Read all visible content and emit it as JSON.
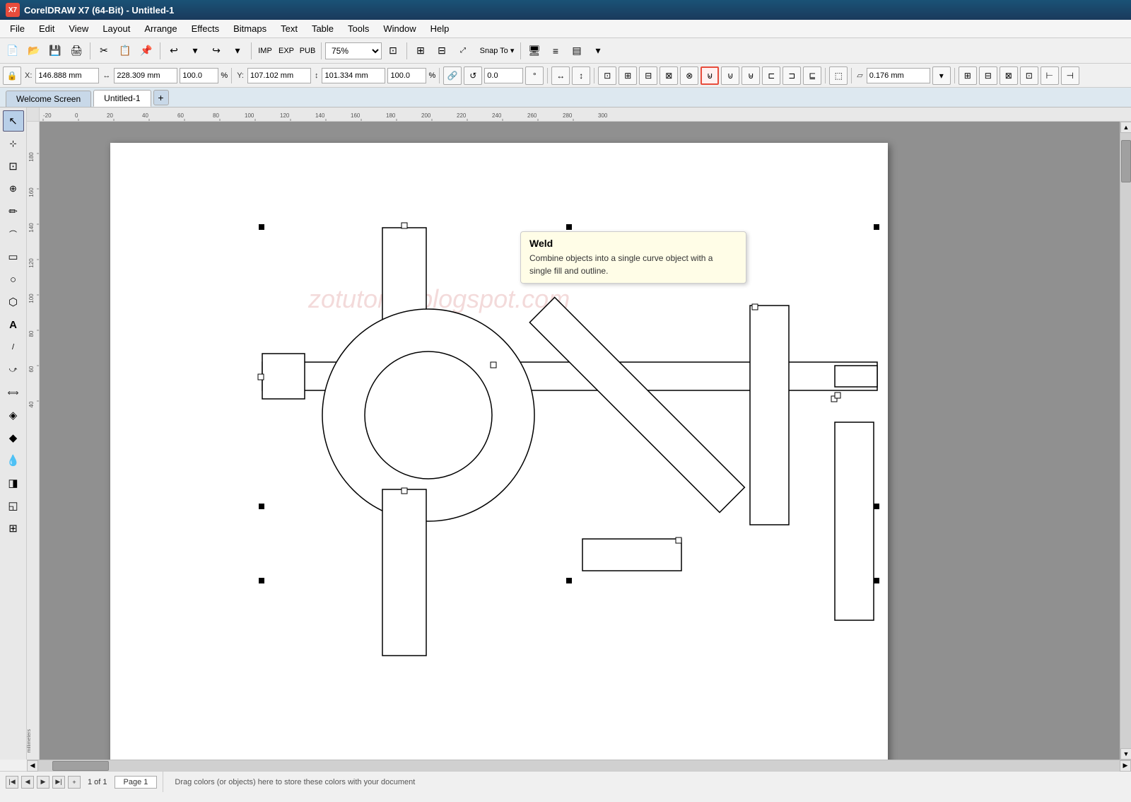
{
  "app": {
    "title": "CorelDRAW X7 (64-Bit) - Untitled-1",
    "logo_text": "X7"
  },
  "menubar": {
    "items": [
      "File",
      "Edit",
      "View",
      "Layout",
      "Arrange",
      "Effects",
      "Bitmaps",
      "Text",
      "Table",
      "Tools",
      "Window",
      "Help"
    ]
  },
  "toolbar": {
    "zoom_value": "75%",
    "snap_to_label": "Snap To"
  },
  "propbar": {
    "x_label": "X:",
    "x_value": "146.888 mm",
    "y_label": "Y:",
    "y_value": "107.102 mm",
    "w_value": "228.309 mm",
    "h_value": "101.334 mm",
    "scale_w": "100.0",
    "scale_h": "100.0",
    "angle_value": "0.0",
    "outline_value": "0.176 mm"
  },
  "tabs": {
    "items": [
      "Welcome Screen",
      "Untitled-1"
    ],
    "active": 1,
    "add_label": "+"
  },
  "tooltip": {
    "title": "Weld",
    "description": "Combine objects into a single curve object with a single fill and outline."
  },
  "canvas": {
    "watermark": "zotutorial.blogspot.com",
    "page_label": "Page 1"
  },
  "statusbar": {
    "page_count": "1 of 1",
    "page_name": "Page 1",
    "message": "Drag colors (or objects) here to store these colors with your document"
  },
  "tools": {
    "items": [
      {
        "name": "select-tool",
        "icon": "↖",
        "label": "Pick Tool"
      },
      {
        "name": "node-tool",
        "icon": "⊹",
        "label": "Node Tool"
      },
      {
        "name": "crop-tool",
        "icon": "⊡",
        "label": "Crop Tool"
      },
      {
        "name": "zoom-tool",
        "icon": "🔍",
        "label": "Zoom Tool"
      },
      {
        "name": "freehand-tool",
        "icon": "✏",
        "label": "Freehand Tool"
      },
      {
        "name": "smart-draw-tool",
        "icon": "⌒",
        "label": "Smart Drawing Tool"
      },
      {
        "name": "rectangle-tool",
        "icon": "▭",
        "label": "Rectangle Tool"
      },
      {
        "name": "ellipse-tool",
        "icon": "○",
        "label": "Ellipse Tool"
      },
      {
        "name": "polygon-tool",
        "icon": "⬡",
        "label": "Polygon Tool"
      },
      {
        "name": "text-tool",
        "icon": "A",
        "label": "Text Tool"
      },
      {
        "name": "parallel-dim-tool",
        "icon": "/",
        "label": "Parallel Dimension Tool"
      },
      {
        "name": "connector-tool",
        "icon": "⤻",
        "label": "Connector Tool"
      },
      {
        "name": "blend-tool",
        "icon": "⟺",
        "label": "Blend Tool"
      },
      {
        "name": "fill-tool",
        "icon": "◈",
        "label": "Fill Tool"
      },
      {
        "name": "smart-fill-tool",
        "icon": "◆",
        "label": "Smart Fill Tool"
      },
      {
        "name": "color-eyedropper-tool",
        "icon": "🔽",
        "label": "Color Eyedropper"
      },
      {
        "name": "interactive-fill-tool",
        "icon": "◨",
        "label": "Interactive Fill Tool"
      },
      {
        "name": "shadow-tool",
        "icon": "◱",
        "label": "Shadow Tool"
      },
      {
        "name": "transform-tool",
        "icon": "⊞",
        "label": "Free Transform Tool"
      }
    ]
  },
  "ruler": {
    "top_marks": [
      -20,
      0,
      20,
      40,
      60,
      80,
      100,
      120,
      140,
      160,
      180,
      200,
      220,
      240,
      260,
      280,
      300
    ],
    "left_marks": [
      40,
      60,
      80,
      100,
      120,
      140,
      160,
      180
    ],
    "unit": "millimeters"
  }
}
